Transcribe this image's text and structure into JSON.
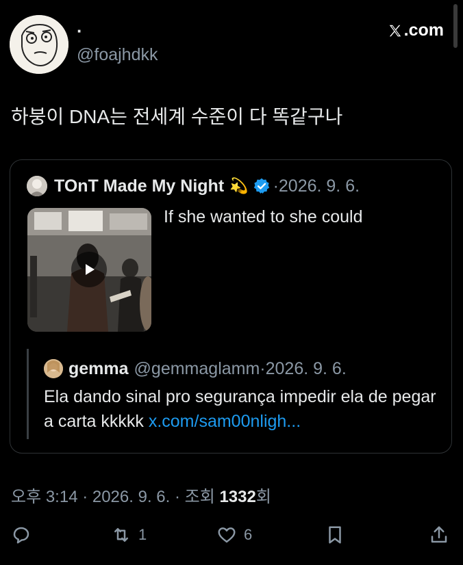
{
  "header": {
    "display_name": "·",
    "handle": "@foajhdkk",
    "brand": ".com"
  },
  "tweet": {
    "text": "하붕이 DNA는 전세계 수준이 다 똑같구나"
  },
  "quote": {
    "name": "TOnT Made My Night",
    "emoji": "💫",
    "date": "·2026. 9. 6.",
    "text": "If she wanted to she could",
    "nested": {
      "name": "gemma",
      "handle": "@gemmaglamm·2026. 9. 6.",
      "text": "Ela dando sinal pro segurança impedir ela de pegar a carta kkkkk ",
      "link": "x.com/sam00nligh..."
    }
  },
  "meta": {
    "time": "오후 3:14 · 2026. 9. 6. · 조회 ",
    "views": "1332",
    "views_suffix": "회"
  },
  "actions": {
    "reply_count": "",
    "retweet_count": "1",
    "like_count": "6"
  },
  "colors": {
    "accent": "#1d9bf0",
    "muted": "#8b98a5",
    "background": "#000000"
  }
}
